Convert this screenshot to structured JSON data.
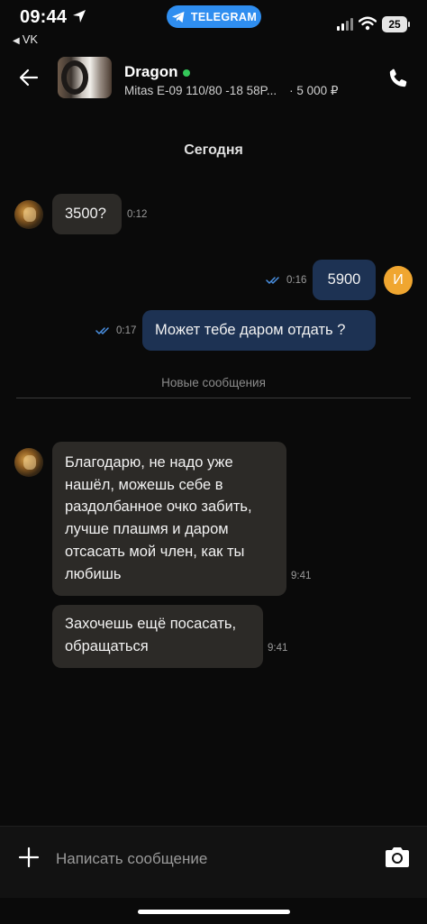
{
  "status_bar": {
    "time": "09:44",
    "back_app": "VK",
    "pill_label": "TELEGRAM",
    "battery": "25"
  },
  "header": {
    "name": "Dragon",
    "listing": "Mitas E-09 110/80 -18 58P...",
    "price": "· 5 000 ₽"
  },
  "chat": {
    "date": "Сегодня",
    "new_messages": "Новые сообщения",
    "messages": [
      {
        "direction": "in",
        "text": "3500?",
        "time": "0:12"
      },
      {
        "direction": "out",
        "text": "5900",
        "time": "0:16",
        "avatar_letter": "И"
      },
      {
        "direction": "out",
        "text": "Может тебе даром отдать ?",
        "time": "0:17"
      },
      {
        "direction": "in",
        "lines": [
          "Благодарю, не надо уже",
          "нашёл, можешь себе в",
          "раздолбанное очко забить,",
          "лучше плашмя и даром",
          "отсасать мой член, как ты",
          "любишь"
        ],
        "time": "9:41"
      },
      {
        "direction": "in",
        "lines": [
          "Захочешь ещё посасать,",
          "обращаться"
        ],
        "time": "9:41"
      }
    ]
  },
  "composer": {
    "placeholder": "Написать сообщение"
  },
  "colors": {
    "background": "#0a0a0a",
    "incoming_bubble": "#2c2a27",
    "outgoing_bubble": "#1d3253",
    "telegram_blue": "#2f8ef0",
    "online": "#34c759",
    "my_avatar": "#f0a630",
    "read_ticks": "#4a90e2"
  },
  "icons": [
    "location-arrow-icon",
    "telegram-icon",
    "signal-icon",
    "wifi-icon",
    "battery-icon",
    "back-arrow-icon",
    "phone-icon",
    "double-check-icon",
    "plus-icon",
    "camera-icon"
  ]
}
